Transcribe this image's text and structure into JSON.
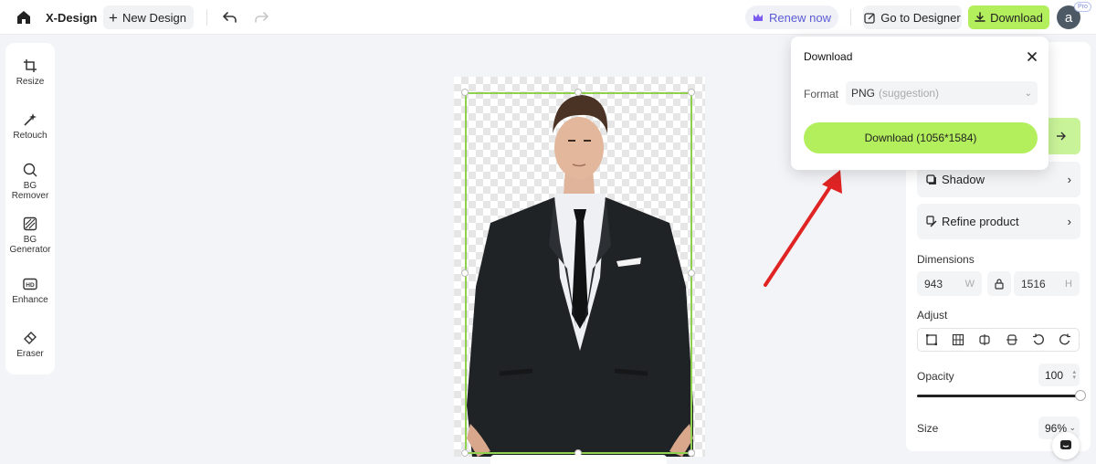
{
  "header": {
    "brand": "X-Design",
    "new_design_label": "New Design",
    "renew_label": "Renew now",
    "go_to_designer_label": "Go to Designer",
    "download_label": "Download",
    "avatar_initial": "a",
    "pro_badge": "Pro"
  },
  "tools": [
    {
      "label": "Resize",
      "icon": "crop-icon"
    },
    {
      "label": "Retouch",
      "icon": "magic-wand-icon"
    },
    {
      "label": "BG\nRemover",
      "icon": "bg-remover-icon"
    },
    {
      "label": "BG\nGenerator",
      "icon": "bg-generator-icon"
    },
    {
      "label": "Enhance",
      "icon": "hd-icon"
    },
    {
      "label": "Eraser",
      "icon": "eraser-icon"
    }
  ],
  "panel": {
    "shadow_label": "Shadow",
    "refine_label": "Refine product",
    "dimensions_label": "Dimensions",
    "width_value": "943",
    "width_unit": "W",
    "height_value": "1516",
    "height_unit": "H",
    "adjust_label": "Adjust",
    "opacity_label": "Opacity",
    "opacity_value": "100",
    "opacity_level": 1.0,
    "size_label": "Size",
    "size_value": "96%"
  },
  "download_popover": {
    "title": "Download",
    "format_label": "Format",
    "format_value": "PNG",
    "format_hint": "(suggestion)",
    "button_label": "Download (1056*1584)"
  },
  "colors": {
    "accent_green": "#b3ee5c",
    "selection_green": "#8fd14f",
    "annotation_arrow": "#e02424"
  }
}
